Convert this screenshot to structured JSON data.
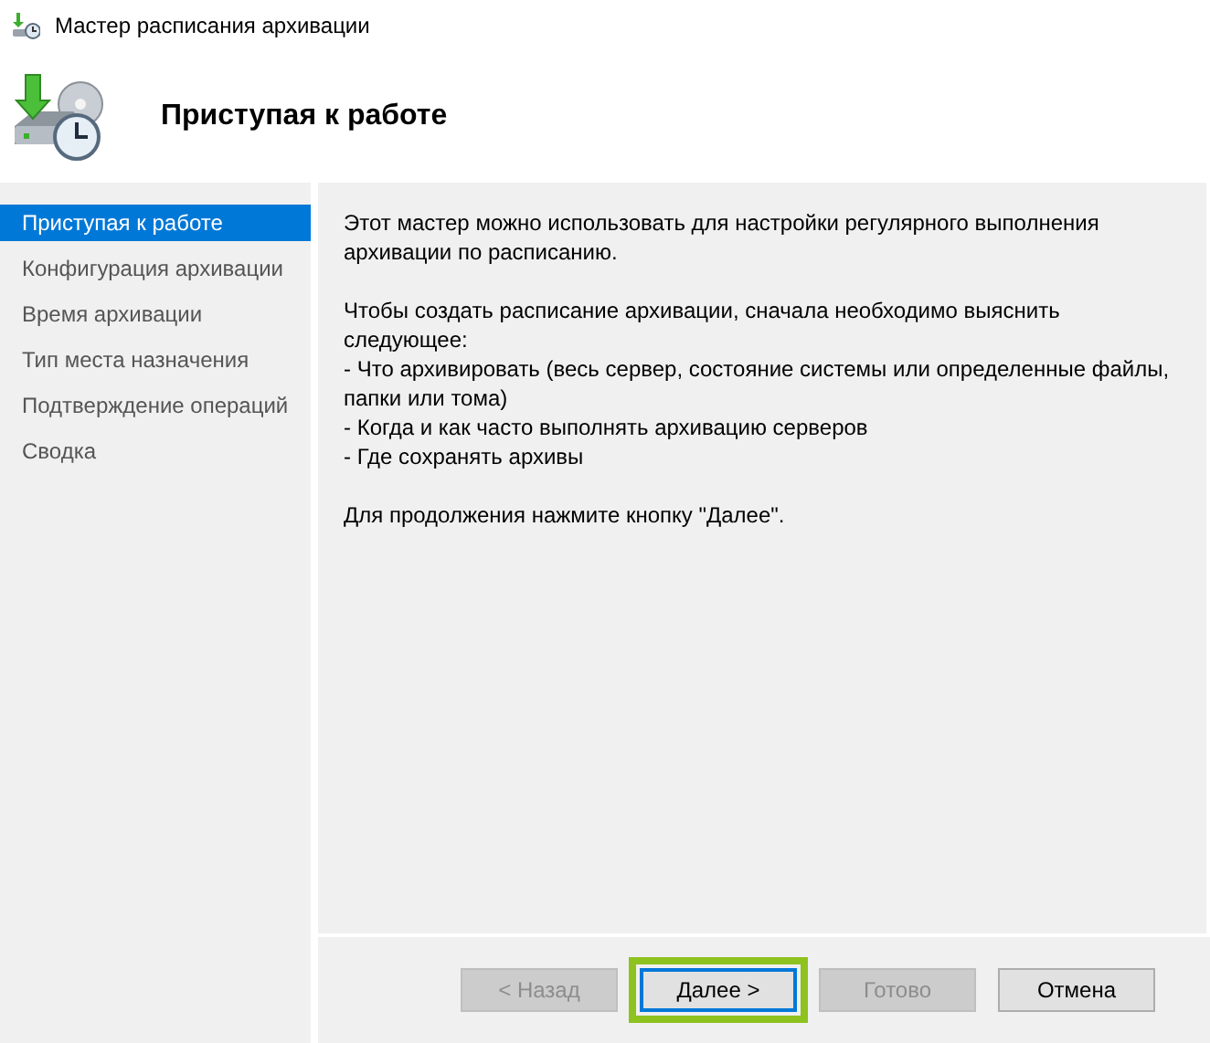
{
  "window": {
    "title": "Мастер расписания архивации"
  },
  "header": {
    "title": "Приступая к работе"
  },
  "steps": [
    {
      "label": "Приступая к работе",
      "selected": true
    },
    {
      "label": "Конфигурация архивации",
      "selected": false
    },
    {
      "label": "Время архивации",
      "selected": false
    },
    {
      "label": "Тип места назначения",
      "selected": false
    },
    {
      "label": "Подтверждение операций",
      "selected": false
    },
    {
      "label": "Сводка",
      "selected": false
    }
  ],
  "content": {
    "intro": "Этот мастер можно использовать для настройки регулярного выполнения архивации по расписанию.",
    "list_intro": "Чтобы создать расписание архивации, сначала необходимо выяснить следующее:",
    "bullets": [
      "-  Что архивировать (весь сервер, состояние системы или определенные файлы, папки или тома)",
      "-  Когда и как часто выполнять архивацию серверов",
      "-  Где сохранять архивы"
    ],
    "outro": "Для продолжения нажмите кнопку \"Далее\"."
  },
  "buttons": [
    {
      "label": "< Назад",
      "disabled": true,
      "focused": false
    },
    {
      "label": "Далее >",
      "disabled": false,
      "focused": true
    },
    {
      "label": "Готово",
      "disabled": true,
      "focused": false
    },
    {
      "label": "Отмена",
      "disabled": false,
      "focused": false
    }
  ]
}
